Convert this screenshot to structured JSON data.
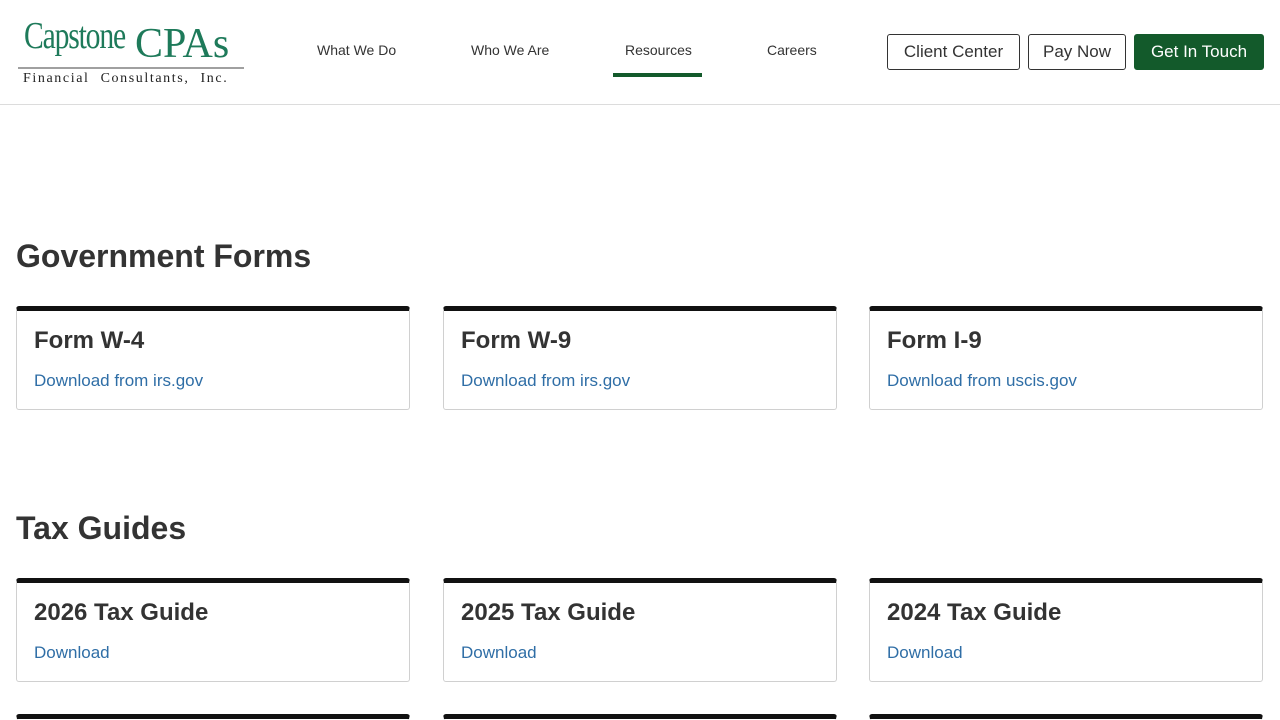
{
  "brand": {
    "logo_main": "Capstone",
    "logo_accent": "CPAs",
    "logo_sub": "Financial Consultants, Inc."
  },
  "nav": {
    "items": [
      {
        "label": "What We Do"
      },
      {
        "label": "Who We Are"
      },
      {
        "label": "Resources",
        "active": true
      },
      {
        "label": "Careers"
      }
    ],
    "client_center": "Client Center",
    "pay_now": "Pay Now",
    "get_in_touch": "Get In Touch"
  },
  "colors": {
    "brand_green": "#135a2b",
    "logo_green": "#1e7a5a",
    "link_blue": "#2f6ea6"
  },
  "government_forms": {
    "title": "Government Forms",
    "cards": [
      {
        "title": "Form W-4",
        "link": "Download from irs.gov"
      },
      {
        "title": "Form W-9",
        "link": "Download from irs.gov"
      },
      {
        "title": "Form I-9",
        "link": "Download from uscis.gov"
      }
    ]
  },
  "tax_guides": {
    "title": "Tax Guides",
    "cards": [
      {
        "title": "2026 Tax Guide",
        "link": "Download"
      },
      {
        "title": "2025 Tax Guide",
        "link": "Download"
      },
      {
        "title": "2024 Tax Guide",
        "link": "Download"
      }
    ]
  }
}
